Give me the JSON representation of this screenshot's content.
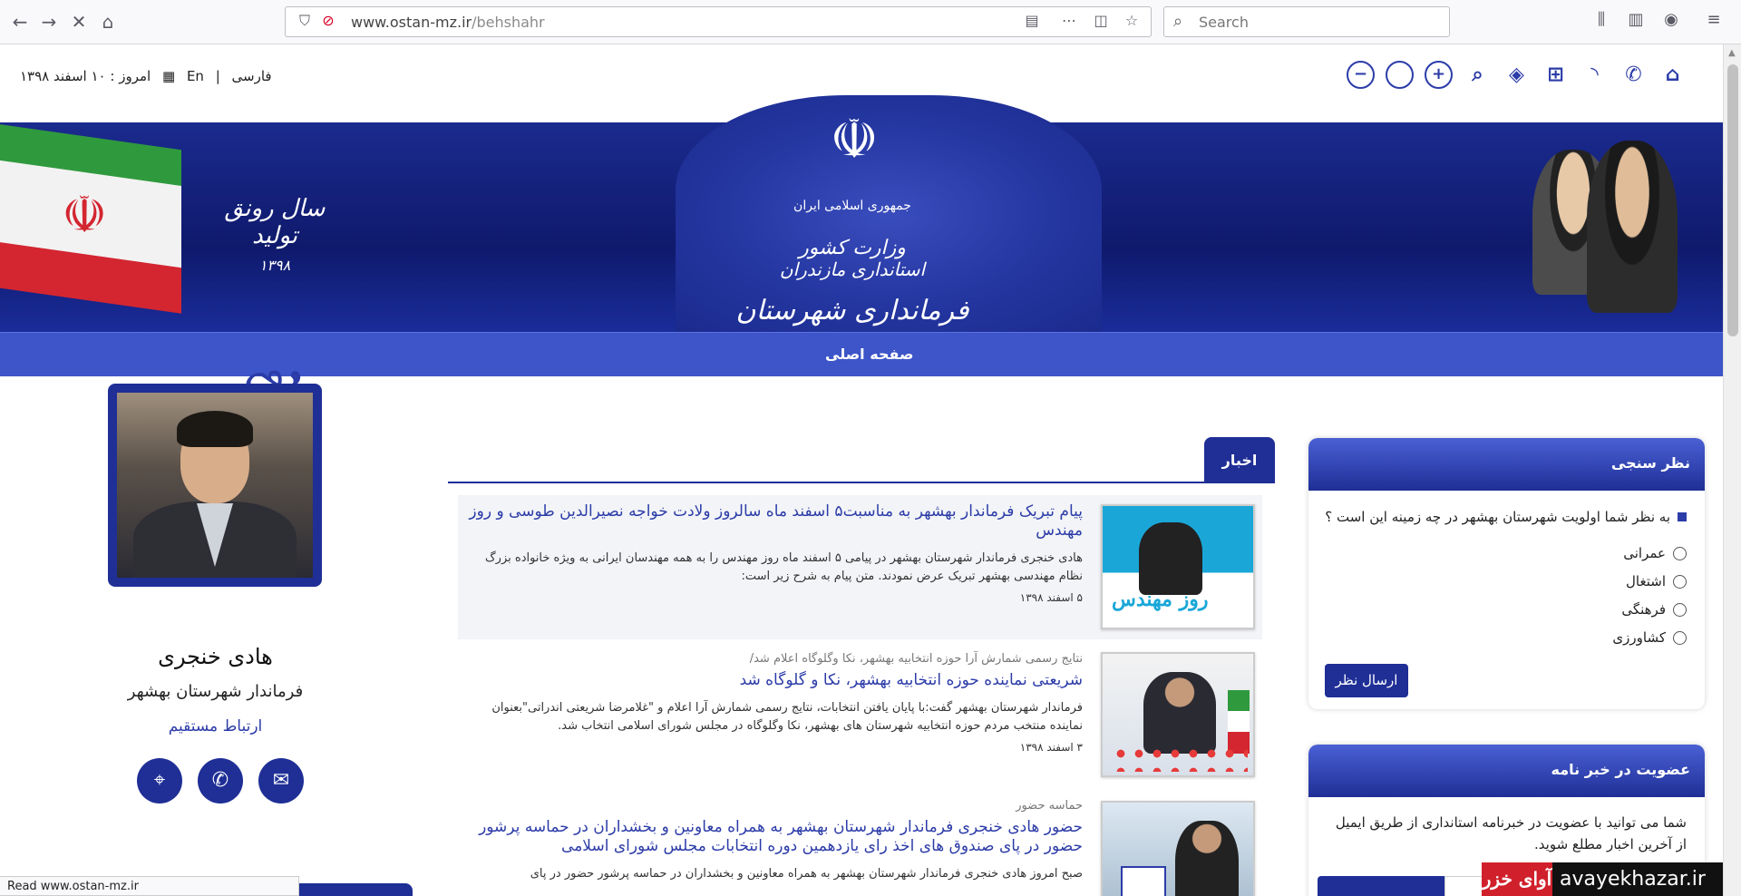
{
  "browser": {
    "url_domain": "www.ostan-mz.ir",
    "url_path": "/behshahr",
    "search_placeholder": "Search"
  },
  "topbar": {
    "lang_fa": "فارسی",
    "lang_sep": "|",
    "lang_en": "En",
    "today": "امروز : ۱۰ اسفند ۱۳۹۸"
  },
  "banner": {
    "line1": "جمهوری اسلامی ایران",
    "line2": "وزارت کشور",
    "line3": "استانداری مازندران",
    "line4": "فرمانداری شهرستان بهشهر",
    "slogan": "سال رونق تولید",
    "slogan_year": "۱۳۹۸"
  },
  "nav": {
    "home": "صفحه اصلی"
  },
  "profile": {
    "name": "هادی خنجری",
    "title": "فرماندار شهرستان بهشهر",
    "link": "ارتباط مستقیم"
  },
  "news": {
    "tab": "اخبار",
    "items": [
      {
        "sup": "",
        "title": "پیام تبریک فرماندار بهشهر به مناسبت۵ اسفند ماه سالروز ولادت خواجه نصیرالدین طوسی و روز مهندس",
        "text": "هادی خنجری فرماندار شهرستان بهشهر در پیامی ۵ اسفند ماه روز مهندس را به همه مهندسان ایرانی به ویژه خانواده بزرگ نظام مهندسی بهشهر تبریک عرض نمودند. متن پیام به شرح زیر است:",
        "date": "۵ اسفند ۱۳۹۸",
        "thumb_label": "روز مهندس"
      },
      {
        "sup": "نتایج رسمی شمارش آرا حوزه انتخابیه بهشهر، نکا وگلوگاه اعلام شد/",
        "title": "شریعتی نماینده حوزه انتخابیه بهشهر، نکا و گلوگاه شد",
        "text": "فرماندار شهرستان بهشهر گفت:با پایان یافتن انتخابات، نتایج رسمی شمارش آرا اعلام و \"غلامرضا شریعتی اندراتی\"بعنوان نماینده منتخب مردم حوزه انتخابیه شهرستان های بهشهر، نکا وگلوگاه در مجلس شورای اسلامی انتخاب شد.",
        "date": "۳ اسفند ۱۳۹۸"
      },
      {
        "sup": "حماسه حضور",
        "title": "حضور هادی خنجری فرماندار شهرستان بهشهر به همراه معاونین و بخشداران در حماسه پرشور حضور در پای صندوق های اخذ رای یازدهمین دوره انتخابات مجلس شورای اسلامی",
        "text": "صبح امروز هادی خنجری فرماندار شهرستان بهشهر به همراه معاونین و بخشداران در حماسه پرشور حضور در پای",
        "date": ""
      }
    ]
  },
  "poll": {
    "header": "نظر سنجی",
    "question": "به نظر شما اولویت شهرستان بهشهر در چه زمینه این است ؟",
    "options": [
      "عمرانی",
      "اشتغال",
      "فرهنگی",
      "کشاورزی"
    ],
    "submit": "ارسال نظر"
  },
  "newsletter": {
    "header": "عضویت در خبر نامه",
    "text": "شما می توانید با عضویت در خبرنامه استانداری از طریق ایمیل از آخرین اخبار مطلع شوید."
  },
  "status_text": "Read www.ostan-mz.ir",
  "watermark": {
    "logo": "آوای خزر",
    "site": "avayekhazar.ir"
  }
}
